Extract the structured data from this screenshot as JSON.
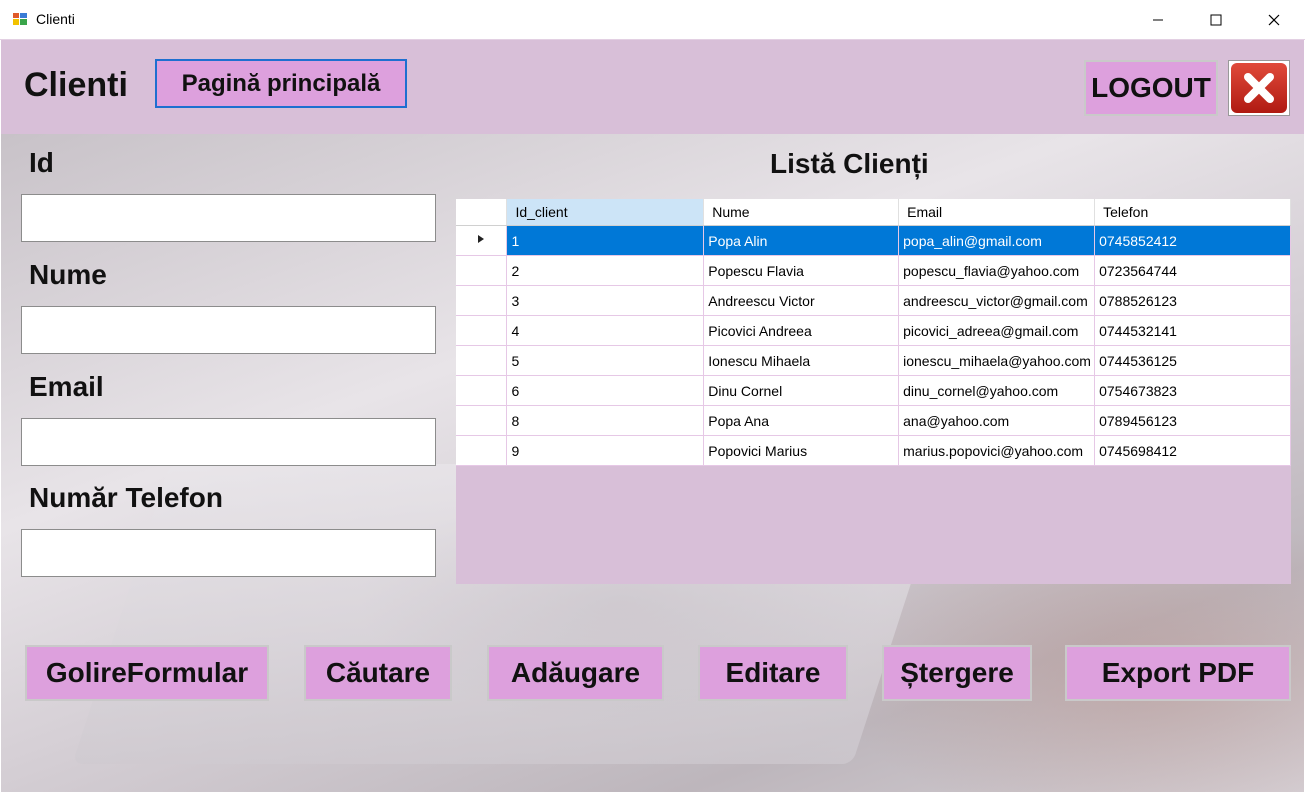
{
  "window": {
    "title": "Clienti"
  },
  "header": {
    "title": "Clienti",
    "home_label": "Pagină principală",
    "logout_label": "LOGOUT"
  },
  "form": {
    "id_label": "Id",
    "id_value": "",
    "name_label": "Nume",
    "name_value": "",
    "email_label": "Email",
    "email_value": "",
    "phone_label": "Număr Telefon",
    "phone_value": ""
  },
  "list": {
    "title": "Listă Clienți",
    "columns": [
      "Id_client",
      "Nume",
      "Email",
      "Telefon"
    ],
    "selected_row": 0,
    "rows": [
      [
        "1",
        "Popa Alin",
        "popa_alin@gmail.com",
        "0745852412"
      ],
      [
        "2",
        "Popescu Flavia",
        "popescu_flavia@yahoo.com",
        "0723564744"
      ],
      [
        "3",
        "Andreescu Victor",
        "andreescu_victor@gmail.com",
        "0788526123"
      ],
      [
        "4",
        "Picovici Andreea",
        "picovici_adreea@gmail.com",
        "0744532141"
      ],
      [
        "5",
        "Ionescu Mihaela",
        "ionescu_mihaela@yahoo.com",
        "0744536125"
      ],
      [
        "6",
        "Dinu Cornel",
        "dinu_cornel@yahoo.com",
        "0754673823"
      ],
      [
        "8",
        "Popa Ana",
        "ana@yahoo.com",
        "0789456123"
      ],
      [
        "9",
        "Popovici Marius",
        "marius.popovici@yahoo.com",
        "0745698412"
      ]
    ]
  },
  "actions": {
    "clear": "GolireFormular",
    "search": "Căutare",
    "add": "Adăugare",
    "edit": "Editare",
    "delete": "Ștergere",
    "export": "Export PDF"
  },
  "colors": {
    "header_bg": "#d8bfd8",
    "button_bg": "#dda0dd",
    "selection": "#0078d7"
  }
}
